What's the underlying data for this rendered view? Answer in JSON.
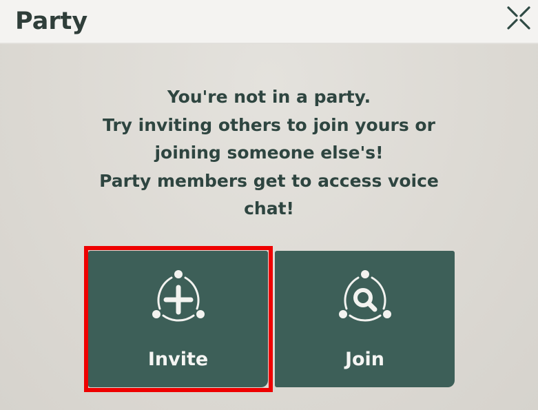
{
  "window": {
    "title": "Party"
  },
  "message": {
    "lines": [
      "You're not in a party.",
      "Try inviting others to join yours or",
      "joining someone else's!",
      "Party members get to access voice",
      "chat!"
    ]
  },
  "buttons": {
    "invite": {
      "label": "Invite",
      "icon": "add-circle-icon"
    },
    "join": {
      "label": "Join",
      "icon": "search-circle-icon"
    }
  },
  "colors": {
    "accent": "#3d5f58",
    "text": "#2e4540",
    "highlight": "#ee0000"
  }
}
